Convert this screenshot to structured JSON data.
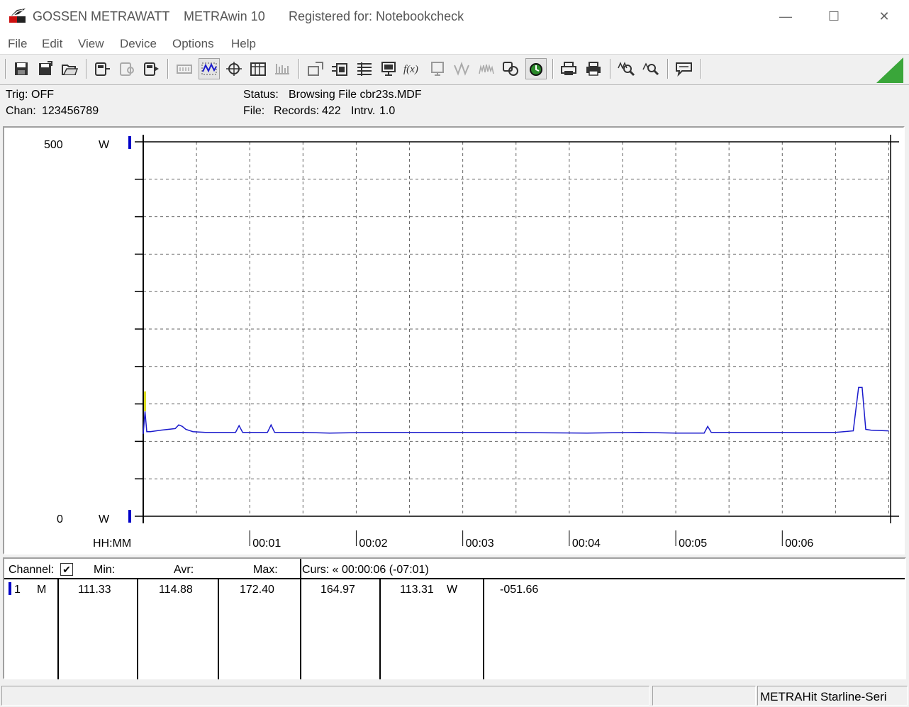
{
  "window": {
    "brand": "GOSSEN METRAWATT",
    "app_name": "METRAwin 10",
    "registered": "Registered for: Notebookcheck",
    "controls": {
      "minimize": "—",
      "maximize": "☐",
      "close": "✕"
    }
  },
  "menu": {
    "file": "File",
    "edit": "Edit",
    "view": "View",
    "device": "Device",
    "options": "Options",
    "help": "Help"
  },
  "toolbar_icons": [
    "save-icon",
    "save-as-icon",
    "open-folder-icon",
    "device-read-icon",
    "device-config-icon",
    "device-start-icon",
    "memory-icon",
    "waveform-view-icon",
    "cursor-crosshair-icon",
    "table-view-icon",
    "bar-grid-icon",
    "export-icon",
    "transfer-icon",
    "list-icon",
    "monitor-icon",
    "function-icon",
    "display-icon",
    "trace-icon",
    "signal-icon",
    "copy-icon",
    "trigger-icon",
    "print-preview-icon",
    "print-icon",
    "zoom-all-icon",
    "zoom-icon",
    "message-icon"
  ],
  "status": {
    "trig_label": "Trig:",
    "trig_value": "OFF",
    "chan_label": "Chan:",
    "chan_value": "123456789",
    "status_label": "Status:",
    "status_value": "Browsing File cbr23s.MDF",
    "file_label": "File:",
    "records_label": "Records:",
    "records_value": "422",
    "intrv_label": "Intrv.",
    "intrv_value": "1.0"
  },
  "chart_data": {
    "type": "line",
    "ylim": [
      0,
      500
    ],
    "y_unit": "W",
    "y_top_label": "500",
    "y_bottom_label": "0",
    "x_axis_label": "HH:MM",
    "x_tick_labels": [
      "00:01",
      "00:02",
      "00:03",
      "00:04",
      "00:05",
      "00:06"
    ],
    "xlim_seconds": [
      0,
      421
    ],
    "grid": true,
    "series": [
      {
        "values_seconds": [
          0,
          1,
          2,
          4,
          10,
          18,
          20,
          22,
          24,
          28,
          35,
          42,
          52,
          54,
          56,
          60,
          70,
          72,
          74,
          76,
          90,
          105,
          130,
          150,
          200,
          250,
          280,
          300,
          316,
          318,
          320,
          330,
          360,
          390,
          400,
          403,
          405,
          407,
          410,
          420
        ],
        "values_watts": [
          110,
          140,
          113,
          113,
          115,
          117,
          122,
          120,
          116,
          113,
          112,
          112,
          112,
          121,
          112,
          112,
          112,
          122,
          112,
          112,
          112,
          111,
          112,
          112,
          112,
          111,
          112,
          111,
          111,
          120,
          112,
          112,
          112,
          112,
          114,
          172,
          172,
          116,
          115,
          114
        ]
      }
    ]
  },
  "table": {
    "headers": {
      "channel": "Channel:",
      "min": "Min:",
      "avr": "Avr:",
      "max": "Max:",
      "curs": "Curs: « 00:00:06 (-07:01)"
    },
    "row": {
      "channel": "1",
      "mode": "M",
      "min": "111.33",
      "avr": "114.88",
      "max": "172.40",
      "cursor_a": "164.97",
      "cursor_b": "113.31",
      "unit": "W",
      "delta": "-051.66"
    }
  },
  "statusbar": {
    "device": "METRAHit Starline-Seri"
  },
  "colors": {
    "trace": "#1a1acc",
    "channel_marker": "#0000c8",
    "cursor_marker": "#d8d820",
    "resize_grip": "#3aa63a"
  }
}
